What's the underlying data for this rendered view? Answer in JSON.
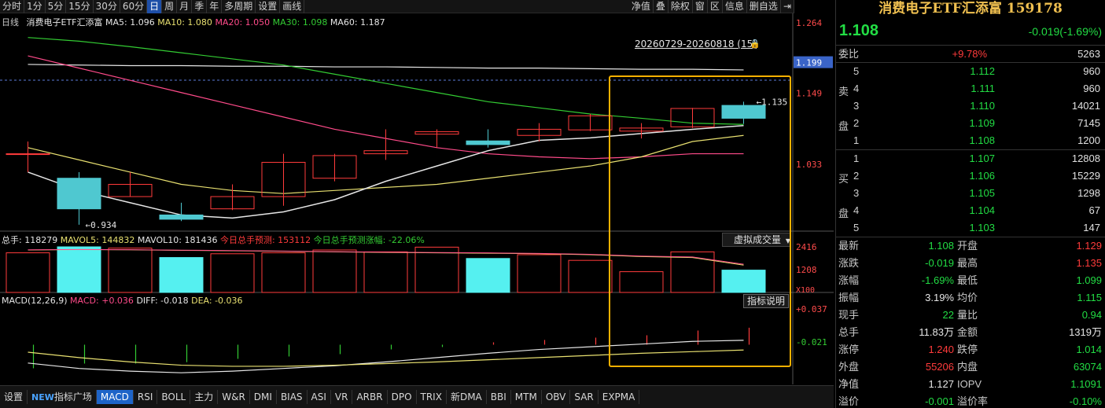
{
  "toolbar": {
    "items": [
      "分时",
      "1分",
      "5分",
      "15分",
      "30分",
      "60分",
      "日",
      "周",
      "月",
      "季",
      "年",
      "多周期",
      "设置",
      "画线"
    ],
    "active_index": 6,
    "right_items": [
      "净值",
      "叠",
      "除权",
      "窗",
      "区",
      "信息",
      "删自选"
    ],
    "pin_icon": "pin-icon"
  },
  "chart_legend": {
    "period": "日线",
    "name": "消费电子ETF汇添富",
    "ma5": "MA5: 1.096",
    "ma10": "MA10: 1.080",
    "ma20": "MA20: 1.050",
    "ma30": "MA30: 1.098",
    "ma60": "MA60: 1.187"
  },
  "range_label": "20260729-20260818 (15)",
  "price_axis": [
    "1.264",
    "1.199",
    "1.149",
    "1.033"
  ],
  "annotations": {
    "high": "1.135",
    "low": "0.934"
  },
  "volume_legend": {
    "total": "总手: 118279",
    "mavol5": "MAVOL5: 144832",
    "mavol10": "MAVOL10: 181436",
    "forecast": "今日总手预测: 153112",
    "forecast_pct": "今日总手预测涨幅: -22.06%"
  },
  "volume_axis": [
    "2416",
    "1208",
    "X100"
  ],
  "virtual_button": "虚拟成交量",
  "macd_legend": {
    "title": "MACD(12,26,9)",
    "macd": "MACD: +0.036",
    "diff": "DIFF: -0.018",
    "dea": "DEA: -0.036"
  },
  "macd_axis": [
    "+0.037",
    "-0.021"
  ],
  "indicator_button": "指标说明",
  "bottom_tabs": [
    "设置",
    "指标广场",
    "MACD",
    "RSI",
    "BOLL",
    "主力",
    "W&R",
    "DMI",
    "BIAS",
    "ASI",
    "VR",
    "ARBR",
    "DPO",
    "TRIX",
    "新DMA",
    "BBI",
    "MTM",
    "OBV",
    "SAR",
    "EXPMA"
  ],
  "bottom_tabs_active": 2,
  "new_badge": "NEW",
  "panel": {
    "title": "消费电子ETF汇添富 159178",
    "price": "1.108",
    "change": "-0.019(-1.69%)",
    "webi": {
      "label": "委比",
      "pct": "+9.78%",
      "diff": "5263"
    },
    "sell_label": "卖盘",
    "buy_label": "买盘",
    "sell": [
      {
        "lvl": "5",
        "price": "1.112",
        "vol": "960"
      },
      {
        "lvl": "4",
        "price": "1.111",
        "vol": "960"
      },
      {
        "lvl": "3",
        "price": "1.110",
        "vol": "14021"
      },
      {
        "lvl": "2",
        "price": "1.109",
        "vol": "7145"
      },
      {
        "lvl": "1",
        "price": "1.108",
        "vol": "1200"
      }
    ],
    "buy": [
      {
        "lvl": "1",
        "price": "1.107",
        "vol": "12808"
      },
      {
        "lvl": "2",
        "price": "1.106",
        "vol": "15229"
      },
      {
        "lvl": "3",
        "price": "1.105",
        "vol": "1298"
      },
      {
        "lvl": "4",
        "price": "1.104",
        "vol": "67"
      },
      {
        "lvl": "5",
        "price": "1.103",
        "vol": "147"
      }
    ],
    "quote": [
      {
        "k": "最新",
        "v": "1.108",
        "vc": "green",
        "k2": "开盘",
        "v2": "1.129",
        "v2c": "red"
      },
      {
        "k": "涨跌",
        "v": "-0.019",
        "vc": "green",
        "k2": "最高",
        "v2": "1.135",
        "v2c": "red"
      },
      {
        "k": "涨幅",
        "v": "-1.69%",
        "vc": "green",
        "k2": "最低",
        "v2": "1.099",
        "v2c": "green"
      },
      {
        "k": "振幅",
        "v": "3.19%",
        "vc": "white",
        "k2": "均价",
        "v2": "1.115",
        "v2c": "green"
      },
      {
        "k": "现手",
        "v": "22",
        "vc": "green",
        "k2": "量比",
        "v2": "0.94",
        "v2c": "green"
      },
      {
        "k": "总手",
        "v": "11.83万",
        "vc": "white",
        "k2": "金额",
        "v2": "1319万",
        "v2c": "white"
      },
      {
        "k": "涨停",
        "v": "1.240",
        "vc": "red",
        "k2": "跌停",
        "v2": "1.014",
        "v2c": "green"
      },
      {
        "k": "外盘",
        "v": "55206",
        "vc": "red",
        "k2": "内盘",
        "v2": "63074",
        "v2c": "green"
      },
      {
        "k": "净值",
        "v": "1.127",
        "vc": "white",
        "k2": "IOPV",
        "v2": "1.1091",
        "v2c": "green"
      },
      {
        "k": "溢价",
        "v": "-0.001",
        "vc": "green",
        "k2": "溢价率",
        "v2": "-0.10%",
        "v2c": "green"
      }
    ]
  },
  "colors": {
    "up": "#ff3b3b",
    "down": "#4fc8d0",
    "ma5": "#e6e6e6",
    "ma10": "#e8e070",
    "ma20": "#ff4b8a",
    "ma30": "#33cc33",
    "highlight": "#f5b000"
  },
  "chart_data": {
    "type": "candlestick",
    "price_range": [
      0.93,
      1.264
    ],
    "candles": [
      {
        "o": 1.05,
        "h": 1.07,
        "l": 1.02,
        "c": 1.05
      },
      {
        "o": 1.01,
        "h": 1.02,
        "l": 0.934,
        "c": 0.96
      },
      {
        "o": 0.98,
        "h": 1.02,
        "l": 0.98,
        "c": 1.0
      },
      {
        "o": 0.95,
        "h": 0.97,
        "l": 0.94,
        "c": 0.943
      },
      {
        "o": 0.96,
        "h": 1.0,
        "l": 0.958,
        "c": 0.98
      },
      {
        "o": 0.98,
        "h": 1.05,
        "l": 0.965,
        "c": 1.036
      },
      {
        "o": 1.01,
        "h": 1.05,
        "l": 1.005,
        "c": 1.047
      },
      {
        "o": 1.05,
        "h": 1.09,
        "l": 1.04,
        "c": 1.055
      },
      {
        "o": 1.082,
        "h": 1.09,
        "l": 1.06,
        "c": 1.086
      },
      {
        "o": 1.071,
        "h": 1.09,
        "l": 1.06,
        "c": 1.065
      },
      {
        "o": 1.08,
        "h": 1.1,
        "l": 1.07,
        "c": 1.09
      },
      {
        "o": 1.089,
        "h": 1.115,
        "l": 1.087,
        "c": 1.112
      },
      {
        "o": 1.087,
        "h": 1.1,
        "l": 1.075,
        "c": 1.092
      },
      {
        "o": 1.094,
        "h": 1.125,
        "l": 1.092,
        "c": 1.124
      },
      {
        "o": 1.129,
        "h": 1.135,
        "l": 1.099,
        "c": 1.108
      }
    ],
    "ma5": [
      1.02,
      0.99,
      0.97,
      0.95,
      0.945,
      0.955,
      0.975,
      1.005,
      1.03,
      1.055,
      1.072,
      1.076,
      1.083,
      1.09,
      1.096
    ],
    "ma10": [
      1.06,
      1.04,
      1.02,
      1.0,
      0.99,
      0.985,
      0.99,
      0.995,
      1.0,
      1.01,
      1.02,
      1.03,
      1.045,
      1.07,
      1.08
    ],
    "ma20": [
      1.21,
      1.19,
      1.17,
      1.15,
      1.13,
      1.11,
      1.09,
      1.075,
      1.06,
      1.05,
      1.045,
      1.042,
      1.045,
      1.05,
      1.05
    ],
    "ma30": [
      1.24,
      1.234,
      1.225,
      1.215,
      1.205,
      1.195,
      1.18,
      1.165,
      1.15,
      1.135,
      1.125,
      1.115,
      1.108,
      1.1,
      1.098
    ],
    "ma60": [
      1.196,
      1.195,
      1.194,
      1.194,
      1.193,
      1.193,
      1.192,
      1.192,
      1.191,
      1.19,
      1.19,
      1.189,
      1.188,
      1.188,
      1.187
    ],
    "volume_range": [
      0,
      2416
    ],
    "volume": [
      2100,
      2416,
      2350,
      1850,
      2050,
      2100,
      2250,
      2150,
      2400,
      1800,
      2000,
      1700,
      1100,
      2150,
      1183
    ],
    "mavol5": [
      2250,
      2270,
      2260,
      2230,
      2210,
      2180,
      2150,
      2120,
      2100,
      2080,
      2050,
      2000,
      1900,
      1850,
      1448
    ],
    "macd": [
      -0.05,
      -0.04,
      -0.04,
      -0.037,
      -0.03,
      -0.025,
      -0.02,
      -0.01,
      -0.005,
      0.005,
      0.01,
      0.015,
      0.02,
      0.03,
      0.036
    ],
    "diff": [
      -0.06,
      -0.07,
      -0.075,
      -0.078,
      -0.075,
      -0.07,
      -0.065,
      -0.058,
      -0.05,
      -0.042,
      -0.035,
      -0.03,
      -0.025,
      -0.02,
      -0.018
    ],
    "dea": [
      -0.04,
      -0.05,
      -0.058,
      -0.064,
      -0.066,
      -0.066,
      -0.064,
      -0.061,
      -0.058,
      -0.054,
      -0.05,
      -0.046,
      -0.042,
      -0.039,
      -0.036
    ],
    "macd_range": [
      -0.085,
      0.037
    ]
  }
}
